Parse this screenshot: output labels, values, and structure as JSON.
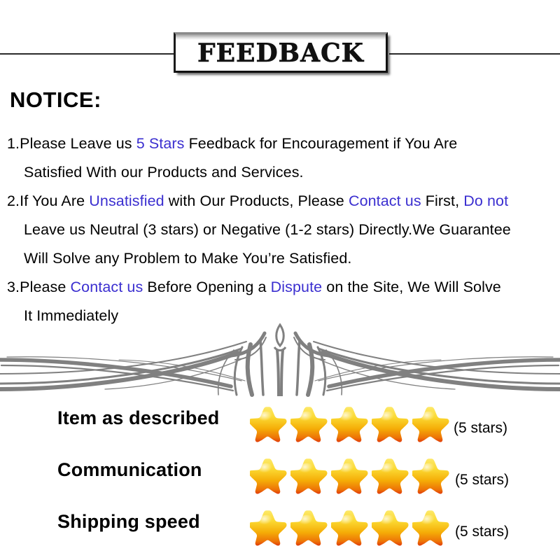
{
  "header": {
    "title": "FEEDBACK"
  },
  "notice": {
    "heading": "NOTICE:",
    "lines": [
      {
        "segments": [
          {
            "text": "1.Please Leave us  ",
            "highlight": false
          },
          {
            "text": "5 Stars",
            "highlight": true
          },
          {
            "text": "  Feedback for  Encouragement  if You Are",
            "highlight": false
          }
        ],
        "indent": false
      },
      {
        "segments": [
          {
            "text": "Satisfied With our Products and Services.",
            "highlight": false
          }
        ],
        "indent": true
      },
      {
        "segments": [
          {
            "text": "2.If You Are ",
            "highlight": false
          },
          {
            "text": "Unsatisfied",
            "highlight": true
          },
          {
            "text": " with Our Products, Please ",
            "highlight": false
          },
          {
            "text": "Contact us",
            "highlight": true
          },
          {
            "text": " First, ",
            "highlight": false
          },
          {
            "text": "Do not",
            "highlight": true
          }
        ],
        "indent": false
      },
      {
        "segments": [
          {
            "text": "Leave us Neutral (3 stars) or Negative (1-2 stars) Directly.We Guarantee",
            "highlight": false
          }
        ],
        "indent": true
      },
      {
        "segments": [
          {
            "text": "Will Solve any Problem to Make You’re  Satisfied.",
            "highlight": false
          }
        ],
        "indent": true
      },
      {
        "segments": [
          {
            "text": "3.Please ",
            "highlight": false
          },
          {
            "text": "Contact us",
            "highlight": true
          },
          {
            "text": " Before Opening a ",
            "highlight": false
          },
          {
            "text": "Dispute",
            "highlight": true
          },
          {
            "text": " on the Site, We Will Solve",
            "highlight": false
          }
        ],
        "indent": false
      },
      {
        "segments": [
          {
            "text": "It Immediately",
            "highlight": false
          }
        ],
        "indent": true
      }
    ],
    "highlight_color": "#3b2fd0"
  },
  "ornament": {
    "icon": "flourish-divider-icon",
    "color": "#808080"
  },
  "ratings": {
    "star_count": 5,
    "star_colors": {
      "top": "#fbe44a",
      "mid": "#f5b800",
      "bottom": "#e85a10",
      "edge": "#e23a0c"
    },
    "rows": [
      {
        "label": "Item as described",
        "caption": "(5 stars)",
        "stars": 5
      },
      {
        "label": "Communication",
        "caption": "(5 stars)",
        "stars": 5
      },
      {
        "label": "Shipping speed",
        "caption": "(5 stars)",
        "stars": 5
      }
    ]
  }
}
